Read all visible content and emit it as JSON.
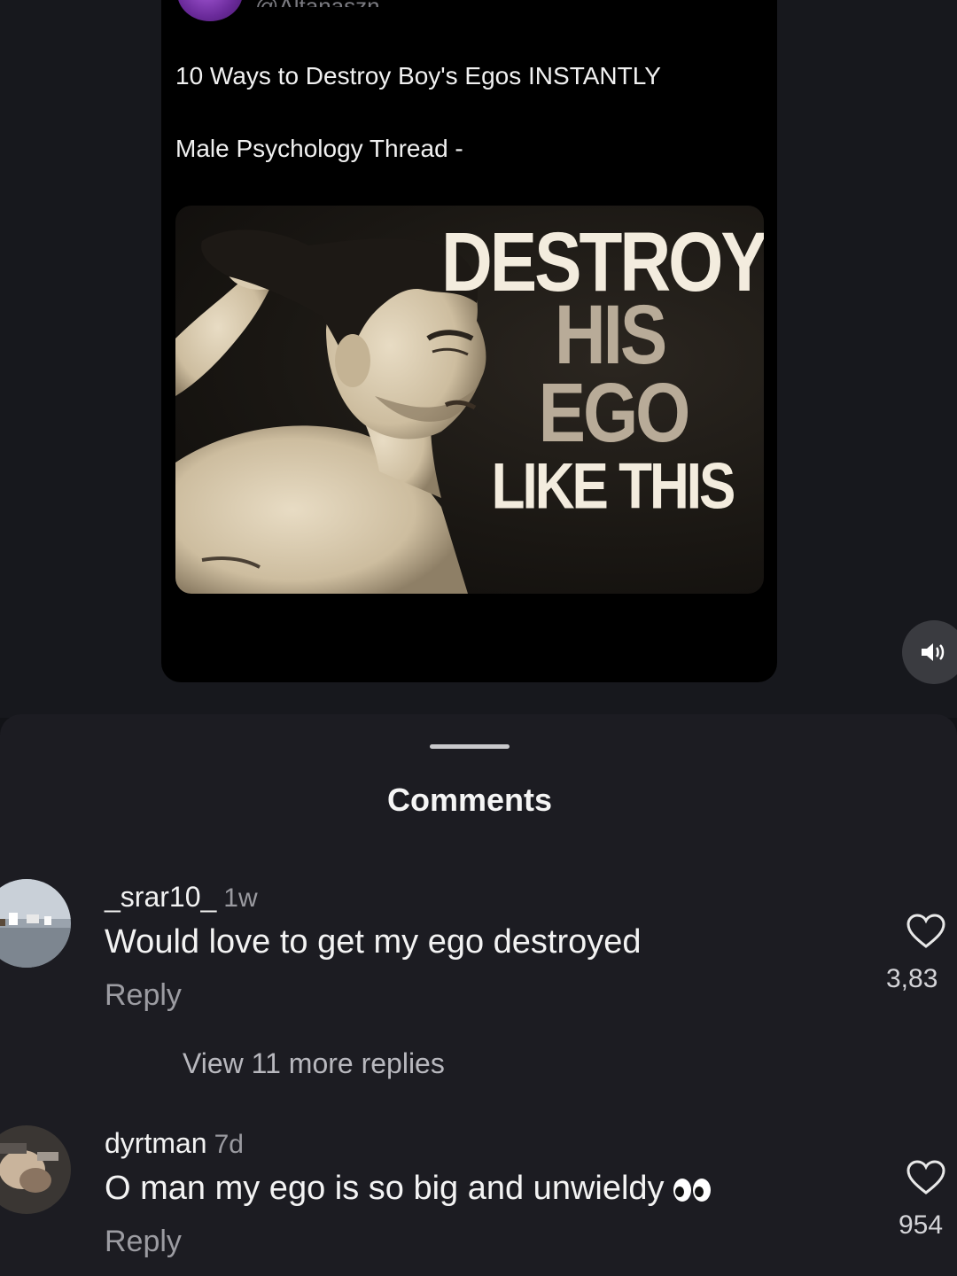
{
  "post": {
    "handle": "@Altanaszn",
    "title": "10 Ways to Destroy Boy's Egos INSTANTLY",
    "subtitle": "Male Psychology Thread -",
    "image_headline": [
      "DESTROY",
      "HIS",
      "EGO",
      "LIKE THIS"
    ]
  },
  "sound_icon": "speaker-icon",
  "comments_sheet": {
    "title": "Comments",
    "comments": [
      {
        "username": "_srar10_",
        "time": "1w",
        "text": "Would love to get my ego destroyed",
        "reply_label": "Reply",
        "likes": "3,83",
        "view_more": "View 11 more replies"
      },
      {
        "username": "dyrtman",
        "time": "7d",
        "text": "O man my ego is so big and unwieldy",
        "reply_label": "Reply",
        "likes": "954"
      }
    ]
  },
  "colors": {
    "background": "#121317",
    "sheet": "#1c1c22",
    "headline_light": "#f3ecde",
    "headline_tan": "#b8ab98"
  }
}
